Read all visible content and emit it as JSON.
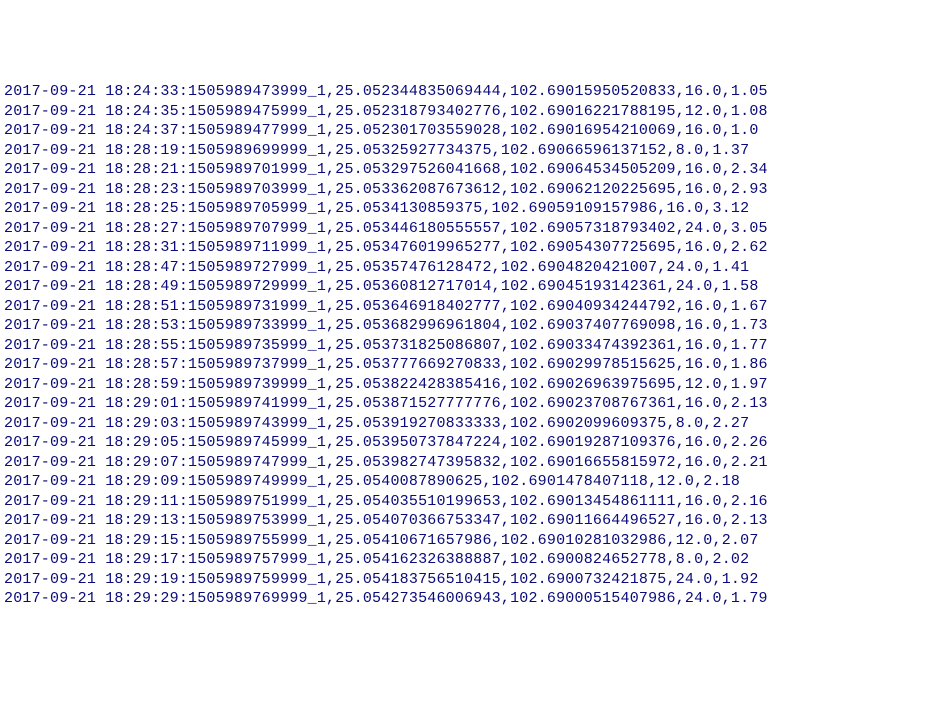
{
  "lines": [
    "2017-09-21 18:24:33:1505989473999_1,25.052344835069444,102.69015950520833,16.0,1.05",
    "2017-09-21 18:24:35:1505989475999_1,25.052318793402776,102.69016221788195,12.0,1.08",
    "2017-09-21 18:24:37:1505989477999_1,25.052301703559028,102.69016954210069,16.0,1.0",
    "2017-09-21 18:28:19:1505989699999_1,25.05325927734375,102.69066596137152,8.0,1.37",
    "2017-09-21 18:28:21:1505989701999_1,25.053297526041668,102.69064534505209,16.0,2.34",
    "2017-09-21 18:28:23:1505989703999_1,25.053362087673612,102.69062120225695,16.0,2.93",
    "2017-09-21 18:28:25:1505989705999_1,25.0534130859375,102.69059109157986,16.0,3.12",
    "2017-09-21 18:28:27:1505989707999_1,25.053446180555557,102.69057318793402,24.0,3.05",
    "2017-09-21 18:28:31:1505989711999_1,25.053476019965277,102.69054307725695,16.0,2.62",
    "2017-09-21 18:28:47:1505989727999_1,25.05357476128472,102.6904820421007,24.0,1.41",
    "2017-09-21 18:28:49:1505989729999_1,25.05360812717014,102.69045193142361,24.0,1.58",
    "2017-09-21 18:28:51:1505989731999_1,25.053646918402777,102.69040934244792,16.0,1.67",
    "2017-09-21 18:28:53:1505989733999_1,25.053682996961804,102.69037407769098,16.0,1.73",
    "2017-09-21 18:28:55:1505989735999_1,25.053731825086807,102.69033474392361,16.0,1.77",
    "2017-09-21 18:28:57:1505989737999_1,25.053777669270833,102.69029978515625,16.0,1.86",
    "2017-09-21 18:28:59:1505989739999_1,25.053822428385416,102.69026963975695,12.0,1.97",
    "2017-09-21 18:29:01:1505989741999_1,25.053871527777776,102.69023708767361,16.0,2.13",
    "2017-09-21 18:29:03:1505989743999_1,25.053919270833333,102.6902099609375,8.0,2.27",
    "2017-09-21 18:29:05:1505989745999_1,25.053950737847224,102.69019287109376,16.0,2.26",
    "2017-09-21 18:29:07:1505989747999_1,25.053982747395832,102.69016655815972,16.0,2.21",
    "2017-09-21 18:29:09:1505989749999_1,25.0540087890625,102.6901478407118,12.0,2.18",
    "2017-09-21 18:29:11:1505989751999_1,25.054035510199653,102.69013454861111,16.0,2.16",
    "2017-09-21 18:29:13:1505989753999_1,25.054070366753347,102.69011664496527,16.0,2.13",
    "2017-09-21 18:29:15:1505989755999_1,25.05410671657986,102.69010281032986,12.0,2.07",
    "2017-09-21 18:29:17:1505989757999_1,25.054162326388887,102.6900824652778,8.0,2.02",
    "2017-09-21 18:29:19:1505989759999_1,25.054183756510415,102.6900732421875,24.0,1.92",
    "2017-09-21 18:29:29:1505989769999_1,25.054273546006943,102.69000515407986,24.0,1.79"
  ]
}
